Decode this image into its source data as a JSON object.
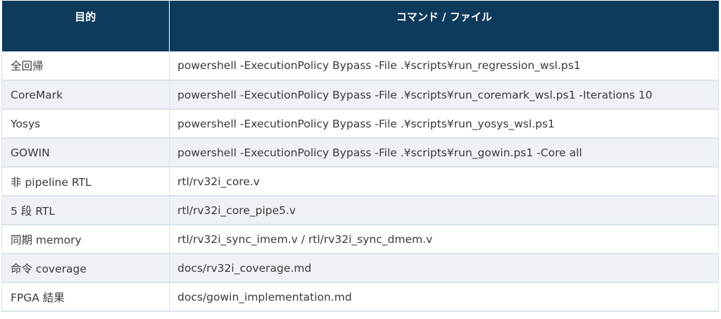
{
  "table": {
    "headers": [
      "目的",
      "コマンド / ファイル"
    ],
    "rows": [
      [
        "全回帰",
        "powershell -ExecutionPolicy Bypass -File .¥scripts¥run_regression_wsl.ps1"
      ],
      [
        "CoreMark",
        "powershell -ExecutionPolicy Bypass -File .¥scripts¥run_coremark_wsl.ps1 -Iterations 10"
      ],
      [
        "Yosys",
        "powershell -ExecutionPolicy Bypass -File .¥scripts¥run_yosys_wsl.ps1"
      ],
      [
        "GOWIN",
        "powershell -ExecutionPolicy Bypass -File .¥scripts¥run_gowin.ps1 -Core all"
      ],
      [
        "非 pipeline RTL",
        "rtl/rv32i_core.v"
      ],
      [
        "5 段 RTL",
        "rtl/rv32i_core_pipe5.v"
      ],
      [
        "同期 memory",
        "rtl/rv32i_sync_imem.v / rtl/rv32i_sync_dmem.v"
      ],
      [
        "命令 coverage",
        "docs/rv32i_coverage.md"
      ],
      [
        "FPGA 結果",
        "docs/gowin_implementation.md"
      ]
    ]
  },
  "colors": {
    "header_bg": "#0e3a5c",
    "header_text": "#ffffff",
    "row_alt_bg": "#eef2f6",
    "border": "#dbe3ea"
  }
}
